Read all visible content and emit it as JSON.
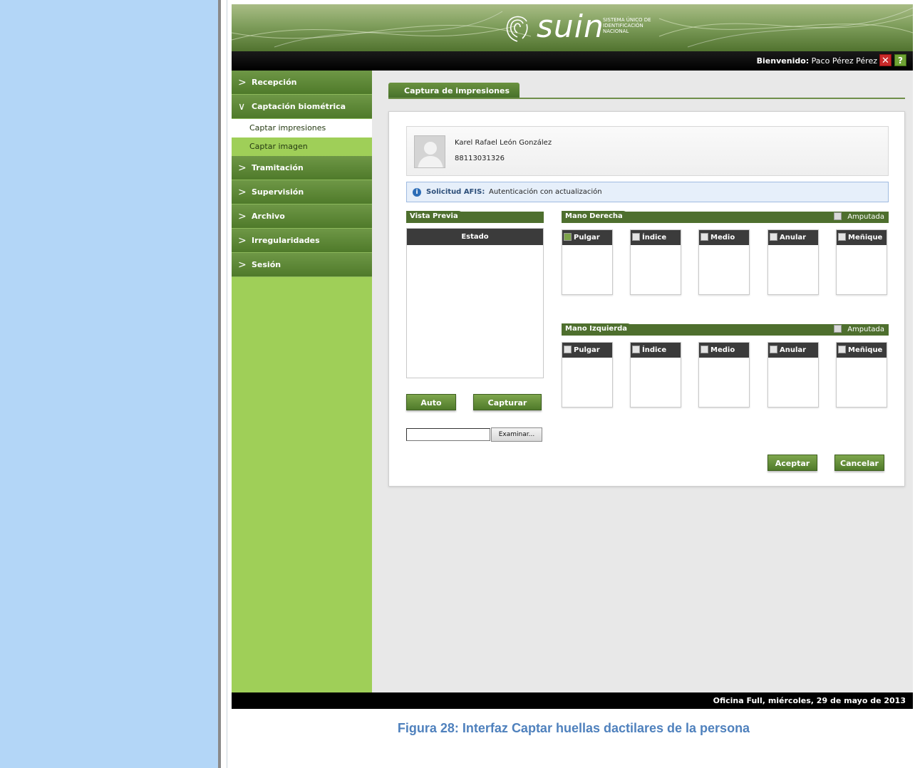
{
  "header": {
    "logo_text": "suin",
    "logo_subtitle": "SISTEMA ÚNICO DE IDENTIFICACIÓN NACIONAL",
    "welcome_label": "Bienvenido:",
    "user_name": "Paco Pérez Pérez",
    "close_icon": "close-icon",
    "help_icon": "help-icon"
  },
  "sidebar": {
    "items": [
      {
        "label": "Recepción"
      },
      {
        "label": "Captación biométrica"
      },
      {
        "label": "Tramitación"
      },
      {
        "label": "Supervisión"
      },
      {
        "label": "Archivo"
      },
      {
        "label": "Irregularidades"
      },
      {
        "label": "Sesión"
      }
    ],
    "subitems": [
      {
        "label": "Captar impresiones"
      },
      {
        "label": "Captar imagen"
      }
    ]
  },
  "main": {
    "tab_title": "Captura de impresiones",
    "person": {
      "name": "Karel Rafael León González",
      "id": "88113031326"
    },
    "afis": {
      "label": "Solicitud AFIS:",
      "value": "Autenticación con actualización"
    },
    "preview": {
      "title": "Vista Previa",
      "status_header": "Estado"
    },
    "right_hand": {
      "title": "Mano Derecha",
      "amputated_label": "Amputada",
      "fingers": [
        "Pulgar",
        "Índice",
        "Medio",
        "Anular",
        "Meñique"
      ]
    },
    "left_hand": {
      "title": "Mano Izquierda",
      "amputated_label": "Amputada",
      "fingers": [
        "Pulgar",
        "Índice",
        "Medio",
        "Anular",
        "Meñique"
      ]
    },
    "buttons": {
      "auto": "Auto",
      "capture": "Capturar",
      "browse": "Examinar...",
      "accept": "Aceptar",
      "cancel": "Cancelar"
    }
  },
  "footer": {
    "status_text": "Oficina Full, miércoles, 29 de mayo de 2013"
  },
  "document": {
    "caption": "Figura 28: Interfaz Captar huellas dactilares de la persona"
  },
  "colors": {
    "sidebar_bg": "#9fcf58",
    "brand_green": "#4e6f2e",
    "caption_blue": "#4f81bd",
    "doc_margin_blue": "#b3d6f7"
  }
}
